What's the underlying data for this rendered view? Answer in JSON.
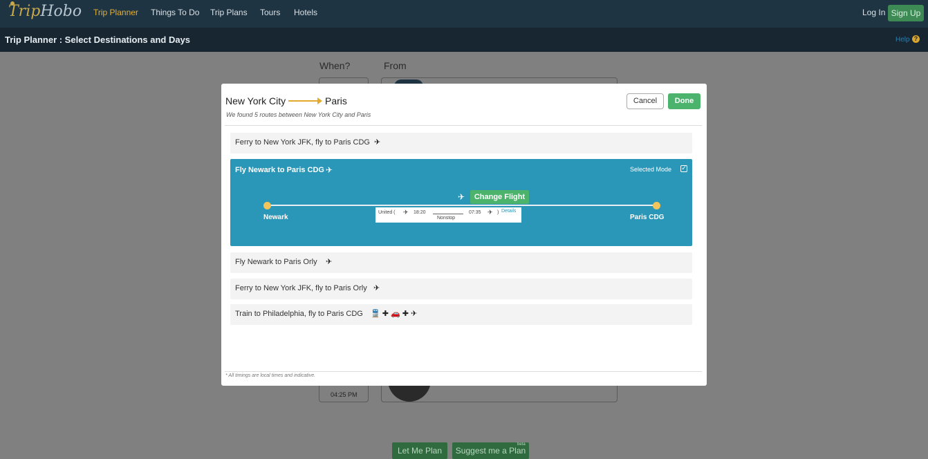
{
  "nav": {
    "logo_trip": "Trip",
    "logo_hobo": "Hobo",
    "items": [
      "Trip Planner",
      "Things To Do",
      "Trip Plans",
      "Tours",
      "Hotels"
    ],
    "login": "Log In",
    "signup": "Sign Up"
  },
  "subheader": {
    "title": "Trip Planner : Select Destinations and Days",
    "help": "Help",
    "help_icon": "?"
  },
  "background": {
    "when_label": "When?",
    "from_label": "From",
    "time": "04:25 PM",
    "let_me_plan": "Let Me Plan",
    "suggest_plan": "Suggest me a Plan",
    "beta": "beta"
  },
  "modal": {
    "from_city": "New York City",
    "to_city": "Paris",
    "found_text": "We found 5 routes between New York City and Paris",
    "cancel": "Cancel",
    "done": "Done",
    "footnote": "* All timings are local times and indicative.",
    "routes": [
      {
        "label": "Ferry to New York JFK, fly to Paris CDG",
        "icons": "✈"
      },
      {
        "label": "Fly Newark to Paris Orly",
        "icons": "✈"
      },
      {
        "label": "Ferry to New York JFK, fly to Paris Orly",
        "icons": "✈"
      },
      {
        "label": "Train to Philadelphia, fly to Paris CDG",
        "icons": "🚆 ✚ 🚗 ✚ ✈"
      }
    ],
    "selected": {
      "label": "Fly Newark to Paris CDG",
      "mode_label": "Selected Mode",
      "change_flight": "Change Flight",
      "origin": "Newark",
      "destination": "Paris CDG",
      "airline": "United (",
      "depart": "18:20",
      "stops": "Nonstop",
      "arrive": "07:35",
      "close_paren": ")",
      "details": "Details"
    }
  }
}
